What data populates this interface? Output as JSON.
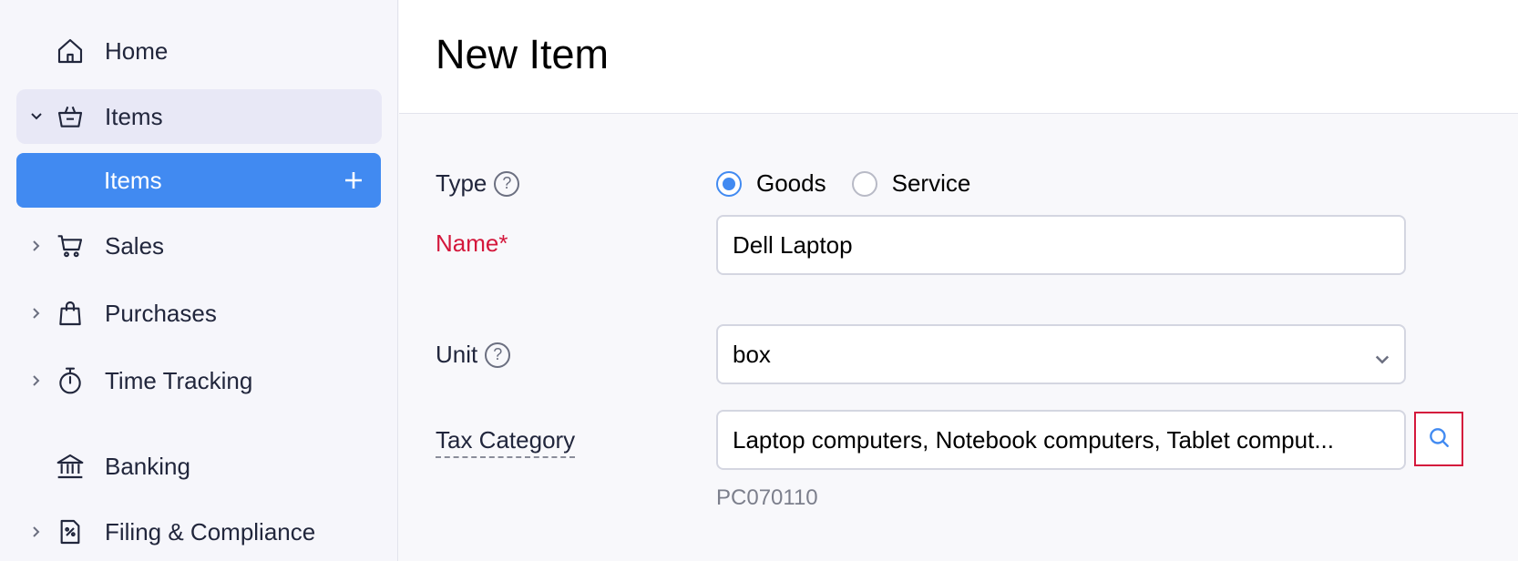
{
  "sidebar": {
    "items": [
      {
        "label": "Home",
        "icon": "home-icon"
      },
      {
        "label": "Items",
        "icon": "basket-icon",
        "expanded": true
      },
      {
        "label": "Sales",
        "icon": "cart-icon"
      },
      {
        "label": "Purchases",
        "icon": "bag-icon"
      },
      {
        "label": "Time Tracking",
        "icon": "stopwatch-icon"
      },
      {
        "label": "Banking",
        "icon": "bank-icon"
      },
      {
        "label": "Filing & Compliance",
        "icon": "filing-icon"
      }
    ],
    "sub_items": [
      {
        "label": "Items",
        "active": true
      }
    ]
  },
  "header": {
    "title": "New Item"
  },
  "form": {
    "type_label": "Type",
    "type_options": [
      "Goods",
      "Service"
    ],
    "type_selected": "Goods",
    "name_label": "Name*",
    "name_value": "Dell Laptop",
    "unit_label": "Unit",
    "unit_value": "box",
    "tax_label": "Tax Category",
    "tax_value": "Laptop computers, Notebook computers, Tablet comput...",
    "tax_code": "PC070110"
  },
  "colors": {
    "accent": "#418af1",
    "required": "#d4183c",
    "highlight_border": "#d4183c"
  }
}
